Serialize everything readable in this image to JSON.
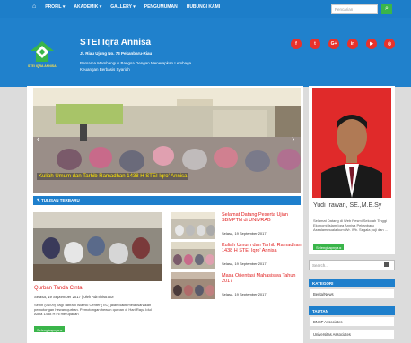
{
  "nav": {
    "items": [
      "PROFIL ▾",
      "AKADEMIK ▾",
      "GALLERY ▾",
      "PENGUMUMAN",
      "HUBUNGI KAMI"
    ],
    "search_placeholder": "Pencarian"
  },
  "header": {
    "title": "STEI Iqra Annisa",
    "address": "Jl. Riau Ujung No. 73 Pekanbaru-Riau",
    "tagline": "Bersama Membangun Bangsa Dengan Menerapkan Lembaga Keuangan Berbasis Syariah",
    "logo_text": "STEI IQRA ANNISA",
    "social": [
      "f",
      "t",
      "G+",
      "in",
      "▶",
      "◎"
    ]
  },
  "slider": {
    "caption": "Kuliah Umum dan Tarhib Ramadhan 1438 H STEI Iqro' Annisa"
  },
  "latest": {
    "heading": "TULISAN TERBARU",
    "featured": {
      "title": "Qurban Tanda Cinta",
      "meta": "Selasa, 19 September 2017 | oleh Administrator",
      "excerpt": "Senin (04/09) pagi Tabrani Islamic Center (TIC) jalan Bakti melaksanakan pemotongan hewan qurban. Pemotongan hewan qurban di Hari Raya Idul Adha 1438 H ini merupakan",
      "button": "Selengkapnya ▸"
    },
    "posts": [
      {
        "title": "Selamat Datang Peserta Ujian SBMPTN di UNIVRAB",
        "date": "Selasa, 19 September 2017"
      },
      {
        "title": "Kuliah Umum dan Tarhib Ramadhan 1438 H STEI Iqro' Annisa",
        "date": "Selasa, 19 September 2017"
      },
      {
        "title": "Masa Orientasi Mahasiswa Tahun 2017",
        "date": "Selasa, 19 September 2017"
      }
    ]
  },
  "profile": {
    "name": "Yudi Irawan, SE.,M.E.Sy",
    "desc": "Selamat Datang di Web Resmi Sekolah Tinggi Ekonomi Islam Iqra Annisa Pekanbaru Assalammualaikum Wr. Wb. Segala puji dan ...",
    "button": "Selengkapnya ▸"
  },
  "sidebar": {
    "search_placeholder": "Search...",
    "kategori": {
      "heading": "KATEGORI",
      "items": [
        "Berita/News"
      ]
    },
    "tautan": {
      "heading": "TAUTAN",
      "items": [
        "BNSP Associates",
        "Universitas Associates"
      ]
    }
  },
  "colors": {
    "primary": "#1e7fcc",
    "accent_red": "#e8322a",
    "button_green": "#3ab54a"
  }
}
